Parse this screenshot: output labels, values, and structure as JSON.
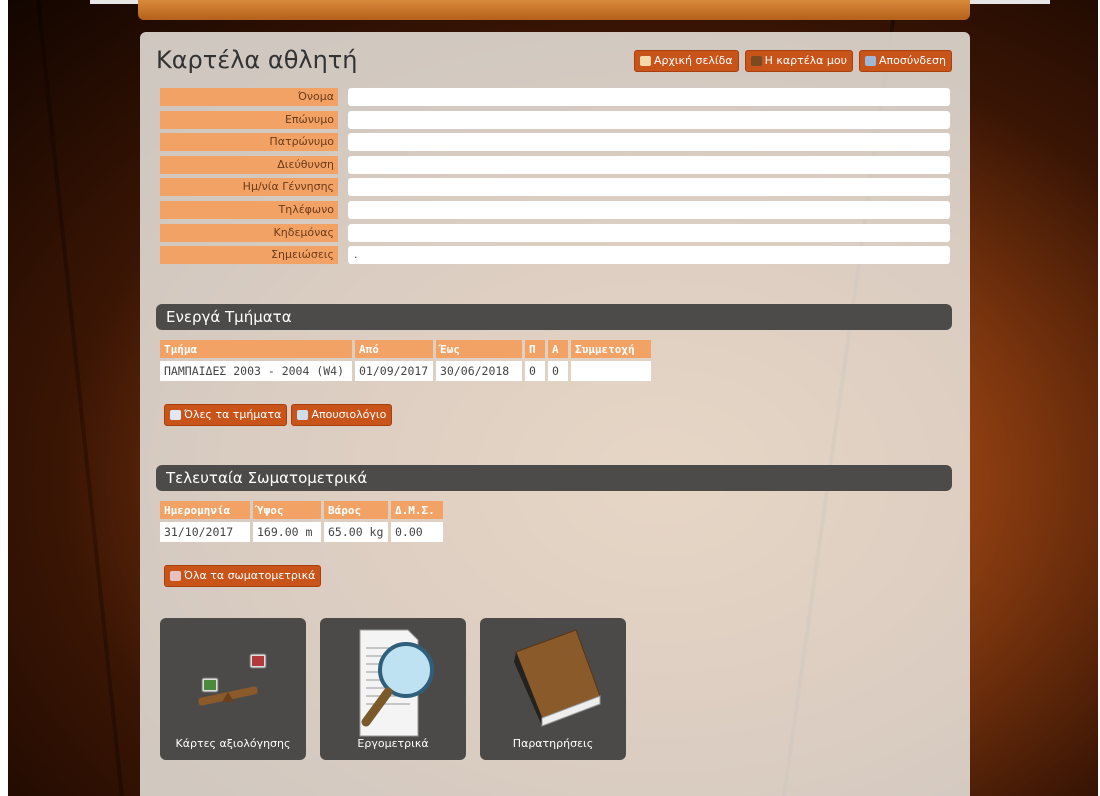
{
  "page": {
    "title": "Καρτέλα αθλητή",
    "nav": {
      "home": "Αρχική σελίδα",
      "my_card": "Η καρτέλα μου",
      "logout": "Αποσύνδεση"
    }
  },
  "profile": {
    "fields": [
      {
        "label": "Όνομα",
        "value": ""
      },
      {
        "label": "Επώνυμο",
        "value": ""
      },
      {
        "label": "Πατρώνυμο",
        "value": ""
      },
      {
        "label": "Διεύθυνση",
        "value": ""
      },
      {
        "label": "Ημ/νία Γέννησης",
        "value": ""
      },
      {
        "label": "Τηλέφωνο",
        "value": ""
      },
      {
        "label": "Κηδεμόνας",
        "value": ""
      },
      {
        "label": "Σημειώσεις",
        "value": "."
      }
    ]
  },
  "active_groups": {
    "heading": "Ενεργά Τμήματα",
    "columns": [
      "Τμήμα",
      "Από",
      "Έως",
      "Π",
      "Α",
      "Συμμετοχή"
    ],
    "rows": [
      [
        "ΠΑΜΠΑΙΔΕΣ 2003 - 2004 (W4)",
        "01/09/2017",
        "30/06/2018",
        "0",
        "0",
        ""
      ]
    ],
    "btn_all_groups": "Όλες τα τμήματα",
    "btn_absences": "Απουσιολόγιο"
  },
  "body_measures": {
    "heading": "Τελευταία Σωματομετρικά",
    "columns": [
      "Ημερομηνία",
      "Ύψος",
      "Βάρος",
      "Δ.Μ.Σ."
    ],
    "rows": [
      [
        "31/10/2017",
        "169.00 m",
        "65.00 kg",
        "0.00"
      ]
    ],
    "btn_all": "Όλα τα σωματομετρικά"
  },
  "tiles": [
    {
      "label": "Κάρτες αξιολόγησης",
      "icon": "scale-icon"
    },
    {
      "label": "Εργομετρικά",
      "icon": "magnifier-document-icon"
    },
    {
      "label": "Παρατηρήσεις",
      "icon": "book-icon"
    }
  ],
  "colors": {
    "accent": "#c9541a",
    "label_bg": "#f3a266",
    "section_bg": "#4d4b4a"
  }
}
